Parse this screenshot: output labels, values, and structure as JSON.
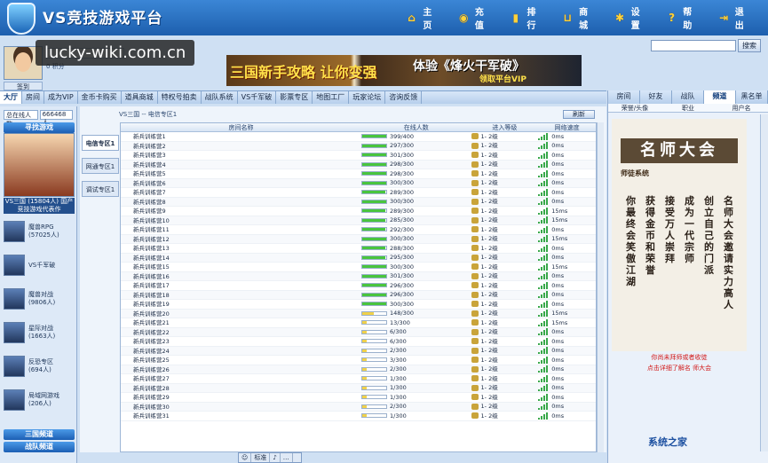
{
  "header": {
    "title": "VS竞技游戏平台",
    "nav": [
      {
        "icon": "home-icon",
        "label": "主页"
      },
      {
        "icon": "coin-icon",
        "label": "充值"
      },
      {
        "icon": "rank-icon",
        "label": "排行"
      },
      {
        "icon": "cart-icon",
        "label": "商城"
      },
      {
        "icon": "gear-icon",
        "label": "设置"
      },
      {
        "icon": "help-icon",
        "label": "帮助"
      },
      {
        "icon": "exit-icon",
        "label": "退出"
      }
    ]
  },
  "user": {
    "level": "0 积分",
    "button": "签到"
  },
  "search": {
    "button": "搜索"
  },
  "banner": {
    "left": "三国新手攻略 让你变强",
    "right": "体验《烽火干军破》",
    "right2": "领取平台VIP"
  },
  "tabs": [
    "大厅",
    "房间",
    "成为VIP",
    "金币卡购买",
    "道具商城",
    "特权号拍卖",
    "战队系统",
    "VS千军破",
    "影票专区",
    "地图工厂",
    "玩家论坛",
    "咨询反馈"
  ],
  "left": {
    "online_label": "总在线人数",
    "online": "666468人",
    "find_game": "寻找游戏",
    "featured_caption": "VS三国 (15804人) 国产竞技游戏代表作",
    "games": [
      {
        "name": "魔兽RPG",
        "count": "(57025人)"
      },
      {
        "name": "VS千军破",
        "count": ""
      },
      {
        "name": "魔兽对战",
        "count": "(9806人)"
      },
      {
        "name": "星际对战",
        "count": "(1663人)"
      },
      {
        "name": "反恐专区",
        "count": "(694人)"
      },
      {
        "name": "局域网游戏",
        "count": "(206人)"
      }
    ],
    "btn1": "三国频道",
    "btn2": "战队频道"
  },
  "mid": {
    "zone_header": "VS三国 -- 电信专区1",
    "zone_btn": "刷新",
    "zones": [
      "电信专区1",
      "网通专区1",
      "调试专区1"
    ],
    "columns": [
      "房间名称",
      "在线人数",
      "进入等级",
      "网络速度"
    ]
  },
  "rooms": [
    {
      "name": "新兵训练营1",
      "count": "399/400",
      "fill": 0.99,
      "level": "1- 2级",
      "speed": "0ms"
    },
    {
      "name": "新兵训练营2",
      "count": "297/300",
      "fill": 0.99,
      "level": "1- 2级",
      "speed": "0ms"
    },
    {
      "name": "新兵训练营3",
      "count": "301/300",
      "fill": 1.0,
      "level": "1- 2级",
      "speed": "0ms"
    },
    {
      "name": "新兵训练营4",
      "count": "298/300",
      "fill": 0.99,
      "level": "1- 2级",
      "speed": "0ms"
    },
    {
      "name": "新兵训练营5",
      "count": "298/300",
      "fill": 0.99,
      "level": "1- 2级",
      "speed": "0ms"
    },
    {
      "name": "新兵训练营6",
      "count": "300/300",
      "fill": 1.0,
      "level": "1- 2级",
      "speed": "0ms"
    },
    {
      "name": "新兵训练营7",
      "count": "289/300",
      "fill": 0.96,
      "level": "1- 2级",
      "speed": "0ms"
    },
    {
      "name": "新兵训练营8",
      "count": "300/300",
      "fill": 1.0,
      "level": "1- 2级",
      "speed": "0ms"
    },
    {
      "name": "新兵训练营9",
      "count": "289/300",
      "fill": 0.96,
      "level": "1- 2级",
      "speed": "15ms"
    },
    {
      "name": "新兵训练营10",
      "count": "285/300",
      "fill": 0.95,
      "level": "1- 2级",
      "speed": "15ms"
    },
    {
      "name": "新兵训练营11",
      "count": "292/300",
      "fill": 0.97,
      "level": "1- 2级",
      "speed": "0ms"
    },
    {
      "name": "新兵训练营12",
      "count": "300/300",
      "fill": 1.0,
      "level": "1- 2级",
      "speed": "15ms"
    },
    {
      "name": "新兵训练营13",
      "count": "288/300",
      "fill": 0.96,
      "level": "1- 2级",
      "speed": "0ms"
    },
    {
      "name": "新兵训练营14",
      "count": "295/300",
      "fill": 0.98,
      "level": "1- 2级",
      "speed": "0ms"
    },
    {
      "name": "新兵训练营15",
      "count": "300/300",
      "fill": 1.0,
      "level": "1- 2级",
      "speed": "15ms"
    },
    {
      "name": "新兵训练营16",
      "count": "301/300",
      "fill": 1.0,
      "level": "1- 2级",
      "speed": "0ms"
    },
    {
      "name": "新兵训练营17",
      "count": "296/300",
      "fill": 0.99,
      "level": "1- 2级",
      "speed": "0ms"
    },
    {
      "name": "新兵训练营18",
      "count": "296/300",
      "fill": 0.99,
      "level": "1- 2级",
      "speed": "0ms"
    },
    {
      "name": "新兵训练营19",
      "count": "300/300",
      "fill": 1.0,
      "level": "1- 2级",
      "speed": "0ms"
    },
    {
      "name": "新兵训练营20",
      "count": "148/300",
      "fill": 0.49,
      "level": "1- 2级",
      "speed": "15ms"
    },
    {
      "name": "新兵训练营21",
      "count": "13/300",
      "fill": 0.04,
      "level": "1- 2级",
      "speed": "15ms"
    },
    {
      "name": "新兵训练营22",
      "count": "6/300",
      "fill": 0.02,
      "level": "1- 2级",
      "speed": "0ms"
    },
    {
      "name": "新兵训练营23",
      "count": "6/300",
      "fill": 0.02,
      "level": "1- 2级",
      "speed": "0ms"
    },
    {
      "name": "新兵训练营24",
      "count": "2/300",
      "fill": 0.01,
      "level": "1- 2级",
      "speed": "0ms"
    },
    {
      "name": "新兵训练营25",
      "count": "3/300",
      "fill": 0.01,
      "level": "1- 2级",
      "speed": "0ms"
    },
    {
      "name": "新兵训练营26",
      "count": "2/300",
      "fill": 0.01,
      "level": "1- 2级",
      "speed": "0ms"
    },
    {
      "name": "新兵训练营27",
      "count": "1/300",
      "fill": 0.0,
      "level": "1- 2级",
      "speed": "0ms"
    },
    {
      "name": "新兵训练营28",
      "count": "1/300",
      "fill": 0.0,
      "level": "1- 2级",
      "speed": "0ms"
    },
    {
      "name": "新兵训练营29",
      "count": "1/300",
      "fill": 0.0,
      "level": "1- 2级",
      "speed": "0ms"
    },
    {
      "name": "新兵训练营30",
      "count": "2/300",
      "fill": 0.01,
      "level": "1- 2级",
      "speed": "0ms"
    },
    {
      "name": "新兵训练营31",
      "count": "1/300",
      "fill": 0.0,
      "level": "1- 2级",
      "speed": "0ms"
    }
  ],
  "toolbar": {
    "label": "标准"
  },
  "right": {
    "tabs": [
      "房间",
      "好友",
      "战队",
      "频道",
      "黑名单"
    ],
    "cols": [
      "荣誉/头像",
      "职业",
      "用户名"
    ],
    "ad_title": "名师大会",
    "ad_sub": "师徒系统",
    "ad_lines": [
      "名师大会邀请实力高人",
      "创立自己的门派",
      "成为一代宗师",
      "接受万人崇拜",
      "获得金币和荣誉",
      "你最终会笑傲江湖"
    ],
    "cta1": "你尚未拜师或者收徒",
    "cta2": "点击详细了解名 师大会"
  },
  "watermark": "lucky-wiki.com.cn",
  "watermark2": "系统之家"
}
